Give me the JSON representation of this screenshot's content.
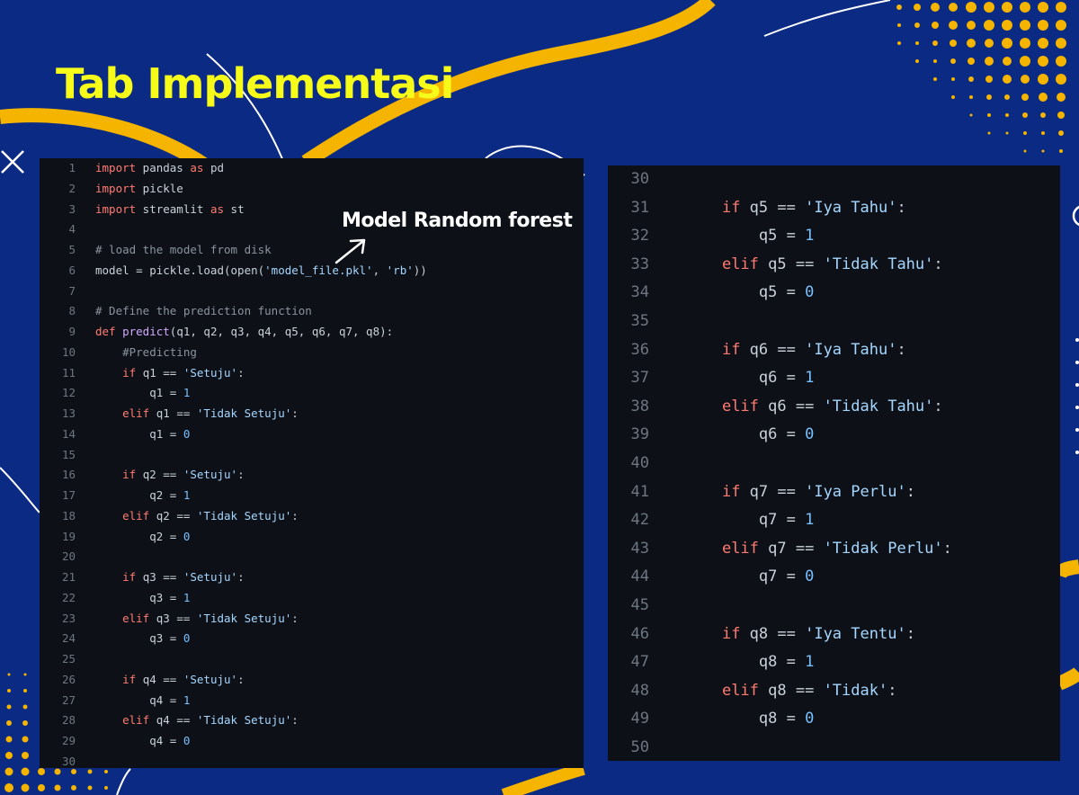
{
  "slide": {
    "title": "Tab Implementasi",
    "annotation": "Model Random forest",
    "colors": {
      "background": "#0b2a83",
      "title": "#f6fb1a",
      "accent_curve": "#f4b400",
      "code_bg": "#0d1117"
    }
  },
  "left_code": {
    "lines": [
      {
        "n": "1",
        "t": [
          [
            "kw",
            "import"
          ],
          [
            "pl",
            " pandas "
          ],
          [
            "kw",
            "as"
          ],
          [
            "pl",
            " pd"
          ]
        ]
      },
      {
        "n": "2",
        "t": [
          [
            "kw",
            "import"
          ],
          [
            "pl",
            " pickle"
          ]
        ]
      },
      {
        "n": "3",
        "t": [
          [
            "kw",
            "import"
          ],
          [
            "pl",
            " streamlit "
          ],
          [
            "kw",
            "as"
          ],
          [
            "pl",
            " st"
          ]
        ]
      },
      {
        "n": "4",
        "t": []
      },
      {
        "n": "5",
        "t": [
          [
            "cm",
            "# load the model from disk"
          ]
        ]
      },
      {
        "n": "6",
        "t": [
          [
            "pl",
            "model = pickle.load(open("
          ],
          [
            "str",
            "'model_file.pkl'"
          ],
          [
            "pl",
            ", "
          ],
          [
            "str",
            "'rb'"
          ],
          [
            "pl",
            "))"
          ]
        ]
      },
      {
        "n": "7",
        "t": []
      },
      {
        "n": "8",
        "t": [
          [
            "cm",
            "# Define the prediction function"
          ]
        ]
      },
      {
        "n": "9",
        "t": [
          [
            "kw",
            "def"
          ],
          [
            "pl",
            " "
          ],
          [
            "fn",
            "predict"
          ],
          [
            "pl",
            "(q1, q2, q3, q4, q5, q6, q7, q8):"
          ]
        ]
      },
      {
        "n": "10",
        "t": [
          [
            "cm",
            "    #Predicting"
          ]
        ]
      },
      {
        "n": "11",
        "t": [
          [
            "pl",
            "    "
          ],
          [
            "kw",
            "if"
          ],
          [
            "pl",
            " q1 == "
          ],
          [
            "str",
            "'Setuju'"
          ],
          [
            "pl",
            ":"
          ]
        ]
      },
      {
        "n": "12",
        "t": [
          [
            "pl",
            "        q1 = "
          ],
          [
            "num",
            "1"
          ]
        ]
      },
      {
        "n": "13",
        "t": [
          [
            "pl",
            "    "
          ],
          [
            "kw",
            "elif"
          ],
          [
            "pl",
            " q1 == "
          ],
          [
            "str",
            "'Tidak Setuju'"
          ],
          [
            "pl",
            ":"
          ]
        ]
      },
      {
        "n": "14",
        "t": [
          [
            "pl",
            "        q1 = "
          ],
          [
            "num",
            "0"
          ]
        ]
      },
      {
        "n": "15",
        "t": []
      },
      {
        "n": "16",
        "t": [
          [
            "pl",
            "    "
          ],
          [
            "kw",
            "if"
          ],
          [
            "pl",
            " q2 == "
          ],
          [
            "str",
            "'Setuju'"
          ],
          [
            "pl",
            ":"
          ]
        ]
      },
      {
        "n": "17",
        "t": [
          [
            "pl",
            "        q2 = "
          ],
          [
            "num",
            "1"
          ]
        ]
      },
      {
        "n": "18",
        "t": [
          [
            "pl",
            "    "
          ],
          [
            "kw",
            "elif"
          ],
          [
            "pl",
            " q2 == "
          ],
          [
            "str",
            "'Tidak Setuju'"
          ],
          [
            "pl",
            ":"
          ]
        ]
      },
      {
        "n": "19",
        "t": [
          [
            "pl",
            "        q2 = "
          ],
          [
            "num",
            "0"
          ]
        ]
      },
      {
        "n": "20",
        "t": []
      },
      {
        "n": "21",
        "t": [
          [
            "pl",
            "    "
          ],
          [
            "kw",
            "if"
          ],
          [
            "pl",
            " q3 == "
          ],
          [
            "str",
            "'Setuju'"
          ],
          [
            "pl",
            ":"
          ]
        ]
      },
      {
        "n": "22",
        "t": [
          [
            "pl",
            "        q3 = "
          ],
          [
            "num",
            "1"
          ]
        ]
      },
      {
        "n": "23",
        "t": [
          [
            "pl",
            "    "
          ],
          [
            "kw",
            "elif"
          ],
          [
            "pl",
            " q3 == "
          ],
          [
            "str",
            "'Tidak Setuju'"
          ],
          [
            "pl",
            ":"
          ]
        ]
      },
      {
        "n": "24",
        "t": [
          [
            "pl",
            "        q3 = "
          ],
          [
            "num",
            "0"
          ]
        ]
      },
      {
        "n": "25",
        "t": []
      },
      {
        "n": "26",
        "t": [
          [
            "pl",
            "    "
          ],
          [
            "kw",
            "if"
          ],
          [
            "pl",
            " q4 == "
          ],
          [
            "str",
            "'Setuju'"
          ],
          [
            "pl",
            ":"
          ]
        ]
      },
      {
        "n": "27",
        "t": [
          [
            "pl",
            "        q4 = "
          ],
          [
            "num",
            "1"
          ]
        ]
      },
      {
        "n": "28",
        "t": [
          [
            "pl",
            "    "
          ],
          [
            "kw",
            "elif"
          ],
          [
            "pl",
            " q4 == "
          ],
          [
            "str",
            "'Tidak Setuju'"
          ],
          [
            "pl",
            ":"
          ]
        ]
      },
      {
        "n": "29",
        "t": [
          [
            "pl",
            "        q4 = "
          ],
          [
            "num",
            "0"
          ]
        ]
      },
      {
        "n": "30",
        "t": []
      }
    ]
  },
  "right_code": {
    "lines": [
      {
        "n": "30",
        "t": []
      },
      {
        "n": "31",
        "t": [
          [
            "pl",
            "    "
          ],
          [
            "kw",
            "if"
          ],
          [
            "pl",
            " q5 == "
          ],
          [
            "str",
            "'Iya Tahu'"
          ],
          [
            "pl",
            ":"
          ]
        ]
      },
      {
        "n": "32",
        "t": [
          [
            "pl",
            "        q5 = "
          ],
          [
            "num",
            "1"
          ]
        ]
      },
      {
        "n": "33",
        "t": [
          [
            "pl",
            "    "
          ],
          [
            "kw",
            "elif"
          ],
          [
            "pl",
            " q5 == "
          ],
          [
            "str",
            "'Tidak Tahu'"
          ],
          [
            "pl",
            ":"
          ]
        ]
      },
      {
        "n": "34",
        "t": [
          [
            "pl",
            "        q5 = "
          ],
          [
            "num",
            "0"
          ]
        ]
      },
      {
        "n": "35",
        "t": []
      },
      {
        "n": "36",
        "t": [
          [
            "pl",
            "    "
          ],
          [
            "kw",
            "if"
          ],
          [
            "pl",
            " q6 == "
          ],
          [
            "str",
            "'Iya Tahu'"
          ],
          [
            "pl",
            ":"
          ]
        ]
      },
      {
        "n": "37",
        "t": [
          [
            "pl",
            "        q6 = "
          ],
          [
            "num",
            "1"
          ]
        ]
      },
      {
        "n": "38",
        "t": [
          [
            "pl",
            "    "
          ],
          [
            "kw",
            "elif"
          ],
          [
            "pl",
            " q6 == "
          ],
          [
            "str",
            "'Tidak Tahu'"
          ],
          [
            "pl",
            ":"
          ]
        ]
      },
      {
        "n": "39",
        "t": [
          [
            "pl",
            "        q6 = "
          ],
          [
            "num",
            "0"
          ]
        ]
      },
      {
        "n": "40",
        "t": []
      },
      {
        "n": "41",
        "t": [
          [
            "pl",
            "    "
          ],
          [
            "kw",
            "if"
          ],
          [
            "pl",
            " q7 == "
          ],
          [
            "str",
            "'Iya Perlu'"
          ],
          [
            "pl",
            ":"
          ]
        ]
      },
      {
        "n": "42",
        "t": [
          [
            "pl",
            "        q7 = "
          ],
          [
            "num",
            "1"
          ]
        ]
      },
      {
        "n": "43",
        "t": [
          [
            "pl",
            "    "
          ],
          [
            "kw",
            "elif"
          ],
          [
            "pl",
            " q7 == "
          ],
          [
            "str",
            "'Tidak Perlu'"
          ],
          [
            "pl",
            ":"
          ]
        ]
      },
      {
        "n": "44",
        "t": [
          [
            "pl",
            "        q7 = "
          ],
          [
            "num",
            "0"
          ]
        ]
      },
      {
        "n": "45",
        "t": []
      },
      {
        "n": "46",
        "t": [
          [
            "pl",
            "    "
          ],
          [
            "kw",
            "if"
          ],
          [
            "pl",
            " q8 == "
          ],
          [
            "str",
            "'Iya Tentu'"
          ],
          [
            "pl",
            ":"
          ]
        ]
      },
      {
        "n": "47",
        "t": [
          [
            "pl",
            "        q8 = "
          ],
          [
            "num",
            "1"
          ]
        ]
      },
      {
        "n": "48",
        "t": [
          [
            "pl",
            "    "
          ],
          [
            "kw",
            "elif"
          ],
          [
            "pl",
            " q8 == "
          ],
          [
            "str",
            "'Tidak'"
          ],
          [
            "pl",
            ":"
          ]
        ]
      },
      {
        "n": "49",
        "t": [
          [
            "pl",
            "        q8 = "
          ],
          [
            "num",
            "0"
          ]
        ]
      },
      {
        "n": "50",
        "t": []
      }
    ]
  }
}
